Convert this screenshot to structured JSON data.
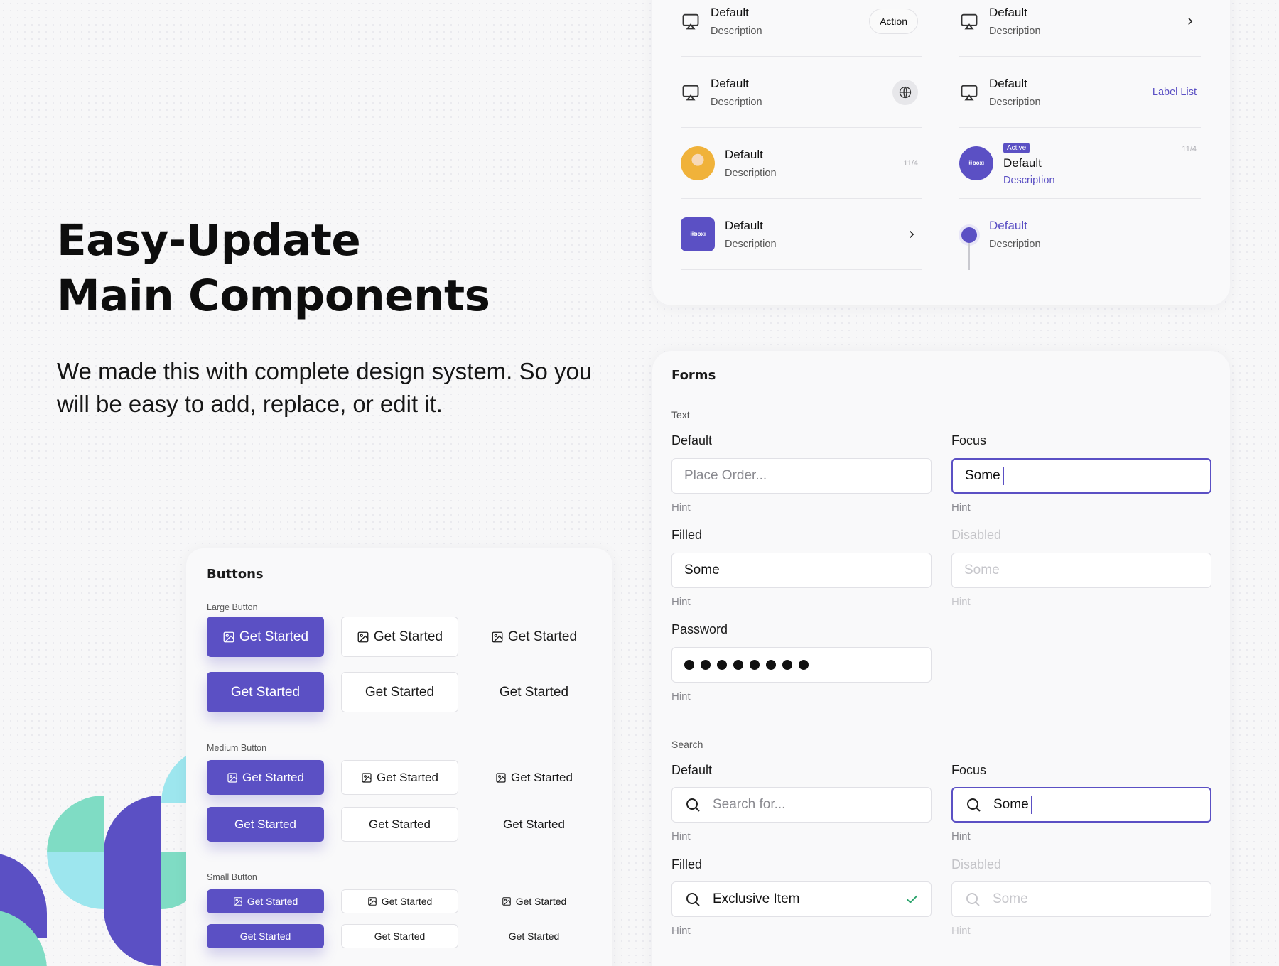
{
  "hero": {
    "title_line1": "Easy-Update",
    "title_line2": "Main Components",
    "paragraph_line1": "We made this with complete design system. So you",
    "paragraph_line2": "will be easy to add, replace, or edit it."
  },
  "list": {
    "items": [
      {
        "title": "Default",
        "description": "Description",
        "right": "Action"
      },
      {
        "title": "Default",
        "description": "Description",
        "right": ""
      },
      {
        "title": "Default",
        "description": "Description",
        "right": ""
      },
      {
        "title": "Default",
        "description": "Description",
        "right": "Label List"
      },
      {
        "title": "Default",
        "description": "Description",
        "counter": "11/4"
      },
      {
        "title": "Default",
        "description": "Description",
        "counter": "11/4",
        "badge": "Active",
        "brand": "boxi"
      },
      {
        "title": "Default",
        "description": "Description",
        "brand": "boxi"
      },
      {
        "title": "Default",
        "description": "Description"
      }
    ]
  },
  "forms": {
    "title": "Forms",
    "text_section": "Text",
    "search_section": "Search",
    "text_default": {
      "label": "Default",
      "placeholder": "Place Order...",
      "hint": "Hint"
    },
    "text_focus": {
      "label": "Focus",
      "value": "Some",
      "hint": "Hint"
    },
    "text_filled": {
      "label": "Filled",
      "value": "Some",
      "hint": "Hint"
    },
    "text_disabled": {
      "label": "Disabled",
      "value": "Some",
      "hint": "Hint"
    },
    "password": {
      "label": "Password",
      "hint": "Hint",
      "dot_count": 8
    },
    "search_default": {
      "label": "Default",
      "placeholder": "Search for...",
      "hint": "Hint"
    },
    "search_focus": {
      "label": "Focus",
      "value": "Some",
      "hint": "Hint"
    },
    "search_filled": {
      "label": "Filled",
      "value": "Exclusive Item",
      "hint": "Hint"
    },
    "search_disabled": {
      "label": "Disabled",
      "value": "Some",
      "hint": "Hint"
    }
  },
  "buttons": {
    "title": "Buttons",
    "large_label": "Large Button",
    "medium_label": "Medium Button",
    "small_label": "Small Button",
    "button_text": "Get Started"
  },
  "colors": {
    "accent": "#5b50c4",
    "teal": "#7fdcc4",
    "cyan": "#9de6ee"
  }
}
